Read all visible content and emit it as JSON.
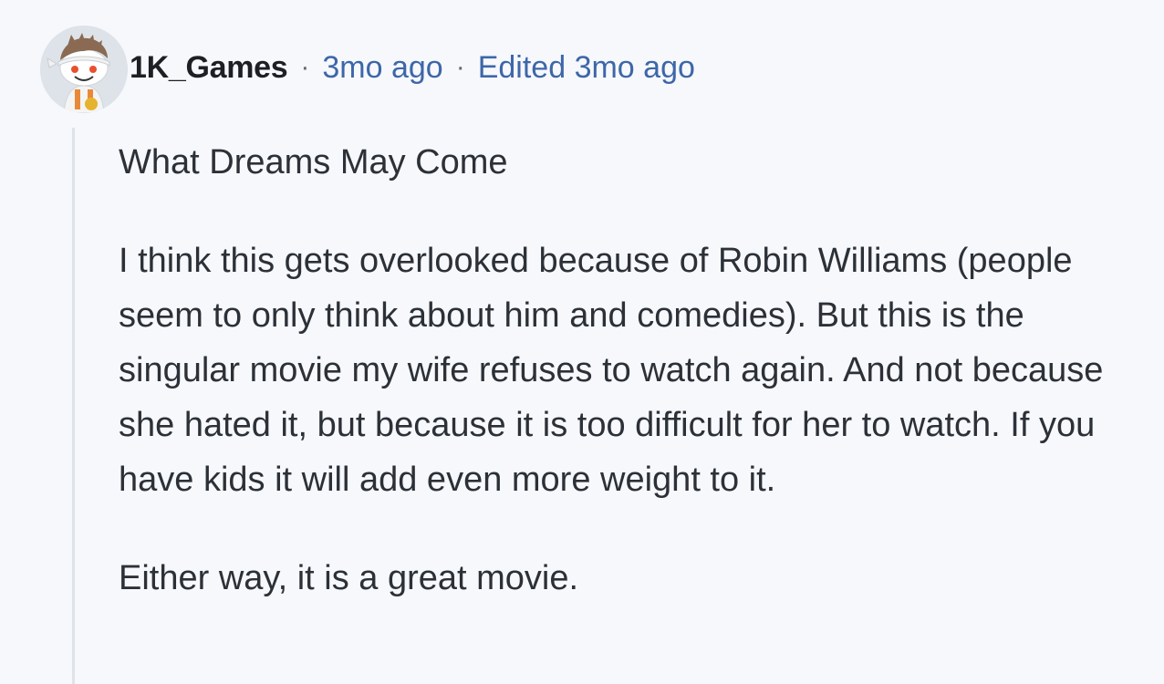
{
  "comment": {
    "username": "1K_Games",
    "separator": "·",
    "timestamp": "3mo ago",
    "edited": "Edited 3mo ago",
    "paragraphs": [
      "What Dreams May Come",
      "I think this gets overlooked because of Robin Williams (people seem to only think about him and comedies). But this is the singular movie my wife refuses to watch again. And not because she hated it, but because it is too difficult for her to watch. If you have kids it will add even more weight to it.",
      "Either way, it is a great movie."
    ],
    "avatar_icon": "snoo-avatar-icon",
    "colors": {
      "background": "#f7f8fc",
      "meta_link": "#3d67a8",
      "thread_line": "#dfe3ea"
    }
  }
}
